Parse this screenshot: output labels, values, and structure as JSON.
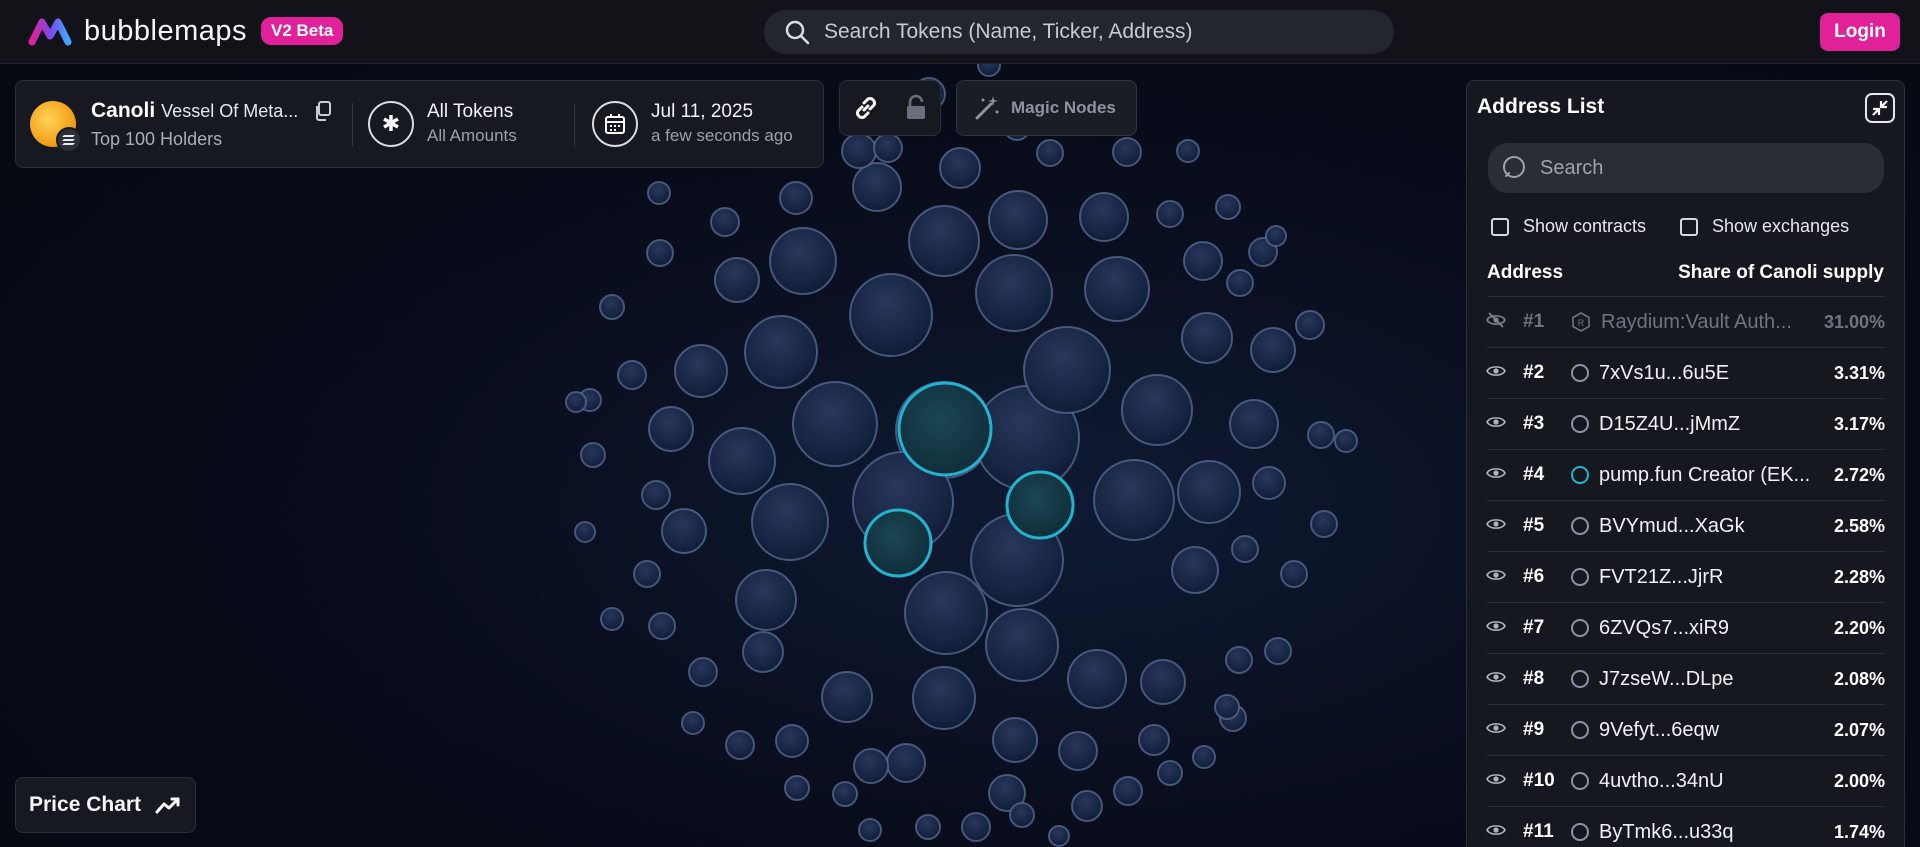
{
  "header": {
    "brand": "bubblemaps",
    "badge": "V2 Beta",
    "search_placeholder": "Search Tokens (Name, Ticker, Address)",
    "login_label": "Login"
  },
  "token": {
    "symbol": "Canoli",
    "name": "Vessel Of Meta...",
    "subtitle": "Top 100 Holders",
    "filter_title": "All Tokens",
    "filter_sub": "All Amounts",
    "date": "Jul 11, 2025",
    "date_sub": "a few seconds ago"
  },
  "tools": {
    "magic_label": "Magic Nodes"
  },
  "price_chart": {
    "label": "Price Chart"
  },
  "address_list": {
    "title": "Address List",
    "search_placeholder": "Search",
    "show_contracts": "Show contracts",
    "show_exchanges": "Show exchanges",
    "col_address": "Address",
    "col_share": "Share of Canoli supply",
    "rows": [
      {
        "rank": "#1",
        "name": "Raydium:Vault Auth...",
        "share": "31.00%"
      },
      {
        "rank": "#2",
        "name": "7xVs1u...6u5E",
        "share": "3.31%"
      },
      {
        "rank": "#3",
        "name": "D15Z4U...jMmZ",
        "share": "3.17%"
      },
      {
        "rank": "#4",
        "name": "pump.fun Creator (EK...",
        "share": "2.72%"
      },
      {
        "rank": "#5",
        "name": "BVYmud...XaGk",
        "share": "2.58%"
      },
      {
        "rank": "#6",
        "name": "FVT21Z...JjrR",
        "share": "2.28%"
      },
      {
        "rank": "#7",
        "name": "6ZVQs7...xiR9",
        "share": "2.20%"
      },
      {
        "rank": "#8",
        "name": "J7zseW...DLpe",
        "share": "2.08%"
      },
      {
        "rank": "#9",
        "name": "9Vefyt...6eqw",
        "share": "2.07%"
      },
      {
        "rank": "#10",
        "name": "4uvtho...34nU",
        "share": "2.00%"
      },
      {
        "rank": "#11",
        "name": "ByTmk6...u33q",
        "share": "1.74%"
      }
    ]
  },
  "colors": {
    "accent": "#e0219a",
    "highlight": "#1fb5d0",
    "bubble": "#1c2a4a"
  }
}
